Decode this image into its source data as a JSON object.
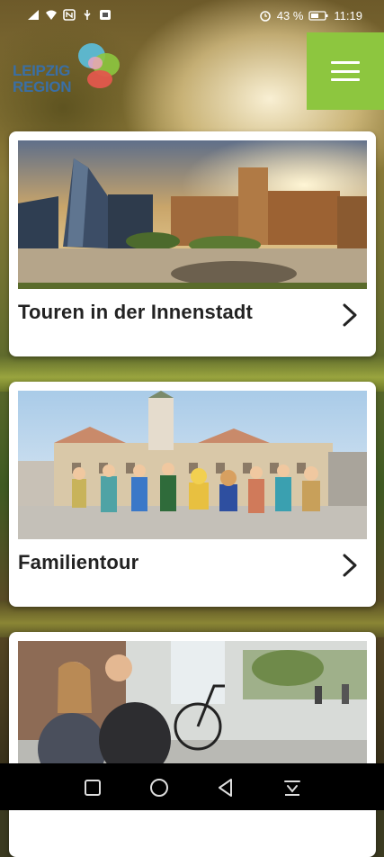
{
  "status_bar": {
    "battery": "43 %",
    "time": "11:19",
    "left_icons": [
      "signal-icon",
      "wifi-icon",
      "nfc-icon",
      "usb-icon",
      "app-icon"
    ],
    "right_icons": [
      "alarm-icon",
      "battery-icon"
    ]
  },
  "header": {
    "logo_line1": "LEIPZIG",
    "logo_line2": "REGION",
    "menu_icon": "hamburger-menu-icon",
    "accent_color": "#8dc63f"
  },
  "cards": [
    {
      "title": "Touren in der Innenstadt",
      "image": "city-square-photo",
      "chevron": "chevron-right-icon"
    },
    {
      "title": "Familientour",
      "image": "family-characters-photo",
      "chevron": "chevron-right-icon"
    },
    {
      "title": "",
      "image": "street-people-photo",
      "chevron": ""
    }
  ],
  "nav_bar": {
    "buttons": [
      "recents-square-icon",
      "home-circle-icon",
      "back-triangle-icon",
      "notification-down-icon"
    ]
  }
}
